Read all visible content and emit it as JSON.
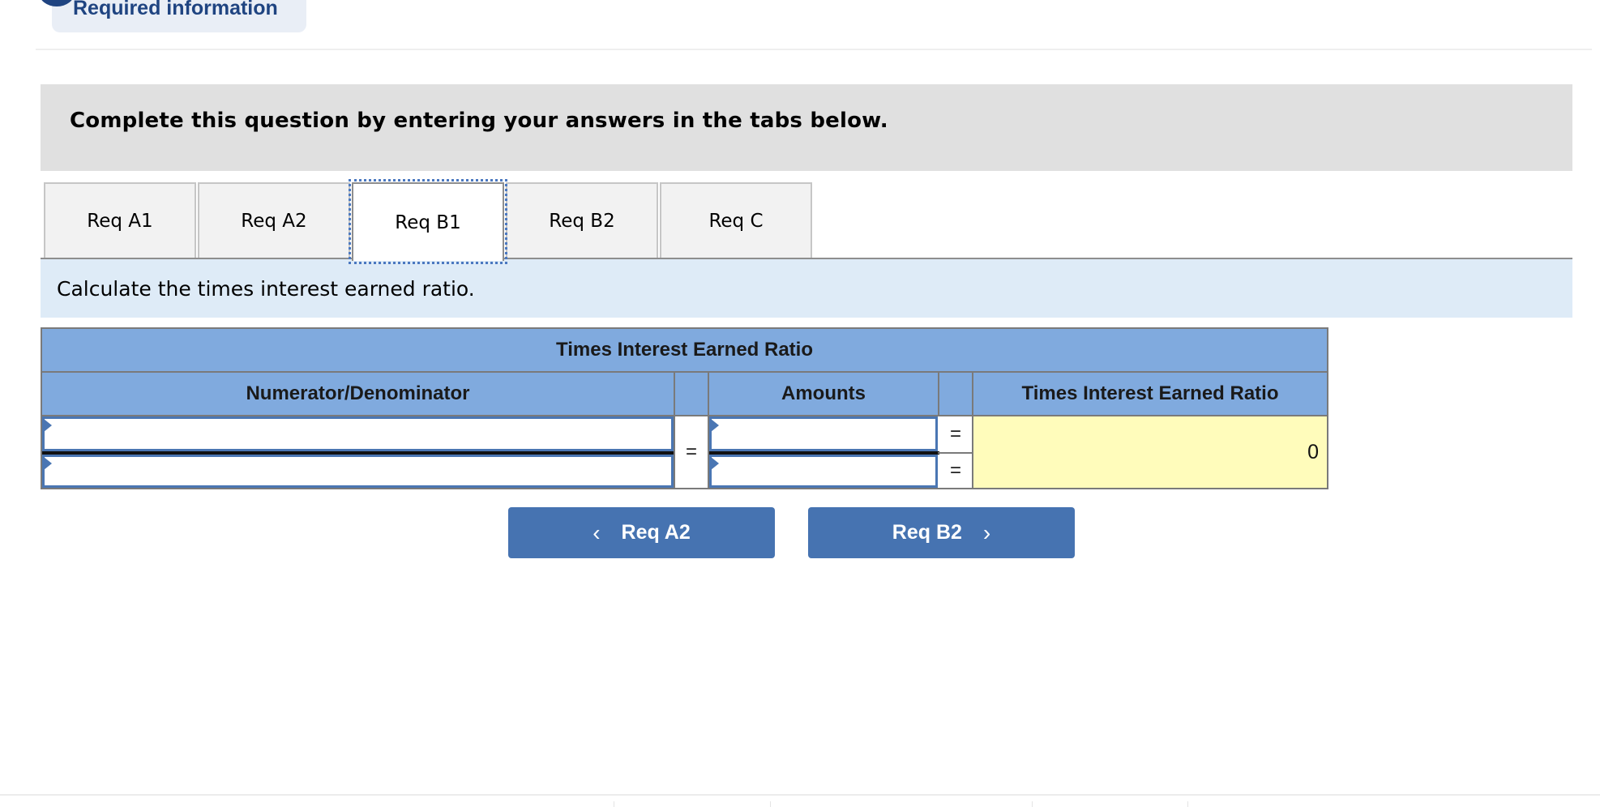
{
  "header": {
    "required_info_label": "Required information"
  },
  "banner": {
    "text": "Complete this question by entering your answers in the tabs below."
  },
  "tabs": [
    {
      "label": "Req A1",
      "active": false
    },
    {
      "label": "Req A2",
      "active": false
    },
    {
      "label": "Req B1",
      "active": true
    },
    {
      "label": "Req B2",
      "active": false
    },
    {
      "label": "Req C",
      "active": false
    }
  ],
  "instruction": "Calculate the times interest earned ratio.",
  "table": {
    "title": "Times Interest Earned Ratio",
    "columns": {
      "numerator_denominator": "Numerator/Denominator",
      "amounts": "Amounts",
      "ratio": "Times Interest Earned Ratio"
    },
    "rows": [
      {
        "label_value": "",
        "amount_value": "",
        "eq": "="
      },
      {
        "label_value": "",
        "amount_value": "",
        "eq": "="
      }
    ],
    "middle_eq": "=",
    "result": "0"
  },
  "nav": {
    "prev_label": "Req A2",
    "next_label": "Req B2",
    "prev_icon": "‹",
    "next_icon": "›"
  },
  "colors": {
    "brand_dark": "#1f4481",
    "header_blue": "#80aade",
    "button_blue": "#4673b1",
    "result_yellow": "#fffcbb",
    "instruction_bg": "#deebf7"
  }
}
